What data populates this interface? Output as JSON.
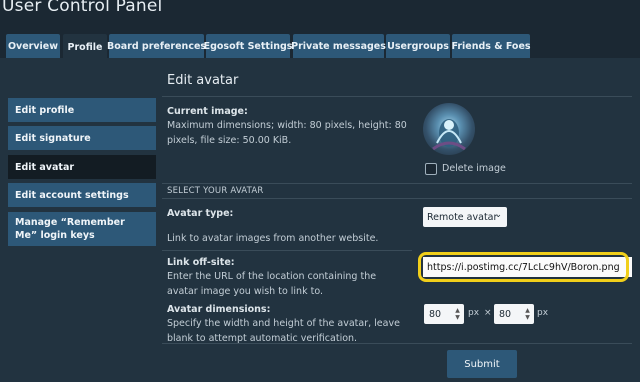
{
  "header": {
    "title": "User Control Panel"
  },
  "tabs": [
    {
      "label": "Overview"
    },
    {
      "label": "Profile"
    },
    {
      "label": "Board preferences"
    },
    {
      "label": "Egosoft Settings"
    },
    {
      "label": "Private messages"
    },
    {
      "label": "Usergroups"
    },
    {
      "label": "Friends & Foes"
    }
  ],
  "sidebar": {
    "items": [
      {
        "label": "Edit profile"
      },
      {
        "label": "Edit signature"
      },
      {
        "label": "Edit avatar"
      },
      {
        "label": "Edit account settings"
      },
      {
        "label": "Manage “Remember Me” login keys"
      }
    ]
  },
  "main": {
    "title": "Edit avatar",
    "current_image": {
      "label": "Current image:",
      "info": "Maximum dimensions; width: 80 pixels, height: 80 pixels, file size: 50.00 KiB."
    },
    "delete_label": "Delete image",
    "select_heading": "SELECT YOUR AVATAR",
    "avatar_type": {
      "label": "Avatar type:",
      "value": "Remote avatar",
      "description": "Link to avatar images from another website."
    },
    "link": {
      "label": "Link off-site:",
      "description": "Enter the URL of the location containing the avatar image you wish to link to.",
      "value": "https://i.postimg.cc/7LcLc9hV/Boron.png"
    },
    "dimensions": {
      "label": "Avatar dimensions:",
      "description": "Specify the width and height of the avatar, leave blank to attempt automatic verification.",
      "width": "80",
      "height": "80",
      "unit": "px",
      "separator": "×"
    },
    "submit_label": "Submit"
  },
  "colors": {
    "background": "#1b2833",
    "panel": "#223340",
    "accent": "#2d5878",
    "highlight": "#f1cf1a"
  }
}
